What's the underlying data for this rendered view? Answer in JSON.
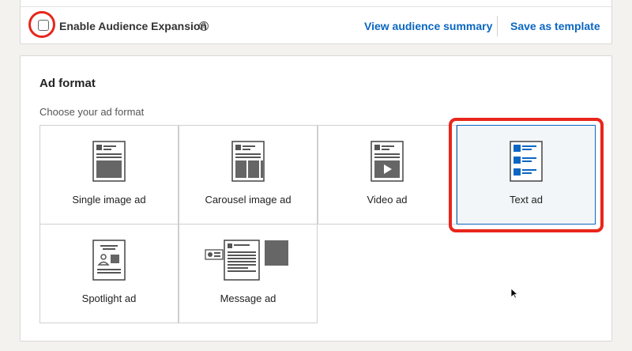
{
  "audience": {
    "expansion_label": "Enable Audience Expansion",
    "help_glyph": "?",
    "view_summary": "View audience summary",
    "save_template": "Save as template"
  },
  "ad_format": {
    "title": "Ad format",
    "subtitle": "Choose your ad format",
    "options": [
      {
        "label": "Single image ad"
      },
      {
        "label": "Carousel image ad"
      },
      {
        "label": "Video ad"
      },
      {
        "label": "Text ad",
        "selected": true
      },
      {
        "label": "Spotlight ad"
      },
      {
        "label": "Message ad"
      }
    ]
  },
  "colors": {
    "accent": "#0a66c2",
    "highlight": "#e8261c"
  }
}
